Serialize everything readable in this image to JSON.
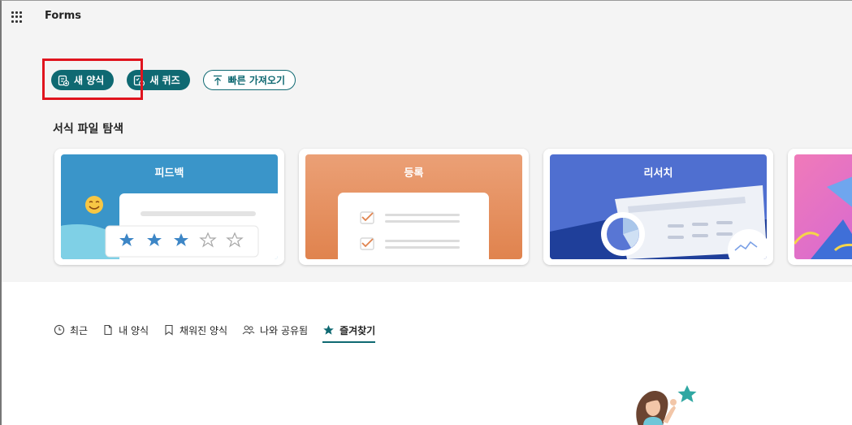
{
  "app": {
    "title": "Forms"
  },
  "actions": {
    "new_form": "새 양식",
    "new_quiz": "새 퀴즈",
    "quick_import": "빠른 가져오기"
  },
  "templates": {
    "section_title": "서식 파일 탐색",
    "cards": [
      {
        "label": "피드백"
      },
      {
        "label": "등록"
      },
      {
        "label": "리서치"
      },
      {
        "label": ""
      }
    ]
  },
  "tabs": [
    {
      "label": "최근",
      "icon": "clock-icon"
    },
    {
      "label": "내 양식",
      "icon": "document-icon"
    },
    {
      "label": "채워진 양식",
      "icon": "bookmark-icon"
    },
    {
      "label": "나와 공유됨",
      "icon": "people-icon"
    },
    {
      "label": "즐겨찾기",
      "icon": "star-icon",
      "active": true
    }
  ],
  "colors": {
    "accent": "#0f6972",
    "highlight": "#e0141e",
    "feedback": "#3a95c9",
    "registration": "#e0834e",
    "research": "#4f6fd0"
  }
}
